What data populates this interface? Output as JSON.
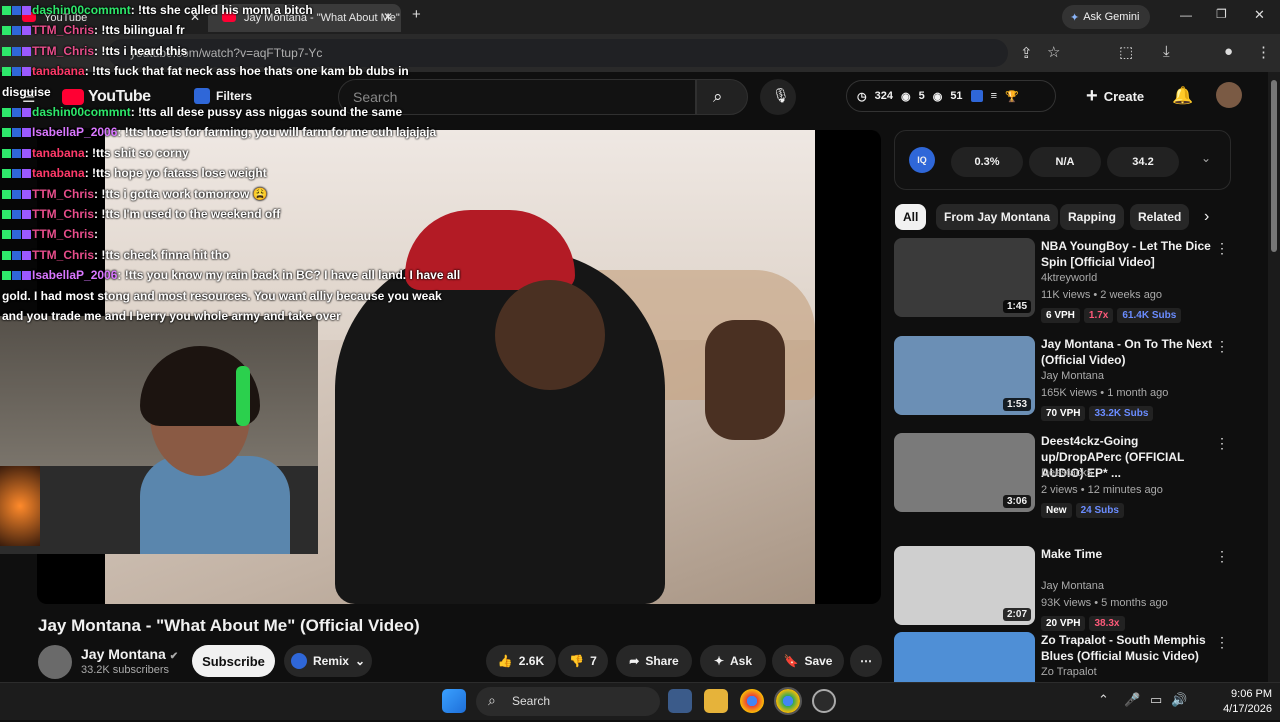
{
  "browser": {
    "tabs": [
      {
        "label": "YouTube"
      },
      {
        "label": "Jay Montana - \"What About Me\""
      }
    ],
    "new_tab": "+",
    "gemini": "Ask Gemini",
    "url": "youtube.com/watch?v=aqFTtup7-Yc"
  },
  "yt_header": {
    "logo": "YouTube",
    "filters": "Filters",
    "search_placeholder": "Search",
    "stat_views": "324",
    "stat_b": "5",
    "stat_c": "51",
    "create": "Create"
  },
  "chat": [
    {
      "user": "dashin00commnt",
      "msg": ": !tts she called his mom a bitch",
      "color": "#2ee86b"
    },
    {
      "user": "TTM_Chris",
      "msg": ": !tts bilingual fr",
      "color": "#e64d8a"
    },
    {
      "user": "TTM_Chris",
      "msg": ": !tts i heard this",
      "color": "#e64d8a"
    },
    {
      "user": "tanabana",
      "msg": ": !tts fuck that fat neck ass hoe thats one kam bb dubs in",
      "color": "#ff3a6a"
    },
    {
      "user": "",
      "msg": "disguise",
      "color": "#ffffff"
    },
    {
      "user": "dashin00commnt",
      "msg": ": !tts all dese pussy ass niggas sound the same",
      "color": "#2ee86b"
    },
    {
      "user": "IsabellaP_2006",
      "msg": ": !tts hoe is for farming, you will farm for me cuh lajajaja",
      "color": "#d977ff"
    },
    {
      "user": "tanabana",
      "msg": ": !tts shit so corny",
      "color": "#ff3a6a"
    },
    {
      "user": "tanabana",
      "msg": ": !tts hope yo fatass lose weight",
      "color": "#ff3a6a"
    },
    {
      "user": "TTM_Chris",
      "msg": ": !tts i gotta work tomorrow 😩",
      "color": "#e64d8a"
    },
    {
      "user": "TTM_Chris",
      "msg": ": !tts I'm used to the weekend off",
      "color": "#e64d8a"
    },
    {
      "user": "TTM_Chris",
      "msg": ": ",
      "color": "#e64d8a"
    },
    {
      "user": "TTM_Chris",
      "msg": ": !tts check finna hit tho",
      "color": "#e64d8a"
    },
    {
      "user": "IsabellaP_2006",
      "msg": ": !tts you know my rain back in BC? I have all land. I have all",
      "color": "#d977ff"
    },
    {
      "user": "",
      "msg": "gold. I had most stong and most resources. You want alliy because you weak",
      "color": "#ffffff"
    },
    {
      "user": "",
      "msg": "and you trade me and I berry you whole army and take over",
      "color": "#ffffff"
    }
  ],
  "video": {
    "title": "Jay Montana - \"What About Me\" (Official Video)",
    "channel": "Jay Montana",
    "subscribers": "33.2K subscribers",
    "subscribe": "Subscribe",
    "remix": "Remix",
    "likes": "2.6K",
    "dislikes": "7",
    "share": "Share",
    "ask": "Ask",
    "save": "Save"
  },
  "iq_panel": {
    "a": "0.3%",
    "b": "N/A",
    "c": "34.2"
  },
  "chips": [
    "All",
    "From Jay Montana",
    "Rapping",
    "Related"
  ],
  "recommendations": [
    {
      "title": "NBA YoungBoy - Let The Dice Spin [Official Video]",
      "channel": "4ktreyworld",
      "meta": "11K views • 2 weeks ago",
      "duration": "1:45",
      "tags": [
        "6 VPH",
        "1.7x",
        "61.4K Subs"
      ],
      "thumb": "#3a3a3a"
    },
    {
      "title": "Jay Montana - On To The Next (Official Video)",
      "channel": "Jay Montana",
      "meta": "165K views • 1 month ago",
      "duration": "1:53",
      "tags": [
        "70 VPH",
        "33.2K Subs"
      ],
      "thumb": "#6b8fb5"
    },
    {
      "title": "Deest4ckz-Going up/DropAPerc (OFFICIAL AUDIO) EP* ...",
      "channel": "Deestacks",
      "meta": "2 views • 12 minutes ago",
      "duration": "3:06",
      "tags": [
        "New",
        "24 Subs"
      ],
      "thumb": "#7a7a7a"
    },
    {
      "title": "Make Time",
      "channel": "Jay Montana",
      "meta": "93K views • 5 months ago",
      "duration": "2:07",
      "tags": [
        "20 VPH",
        "38.3x"
      ],
      "thumb": "#cfcfcf"
    },
    {
      "title": "Zo Trapalot - South Memphis Blues (Official Music Video)",
      "channel": "Zo Trapalot",
      "meta": "",
      "duration": "",
      "tags": [],
      "thumb": "#4f8fd6"
    }
  ],
  "taskbar": {
    "search": "Search",
    "time": "9:06 PM",
    "date": "4/17/2026"
  }
}
